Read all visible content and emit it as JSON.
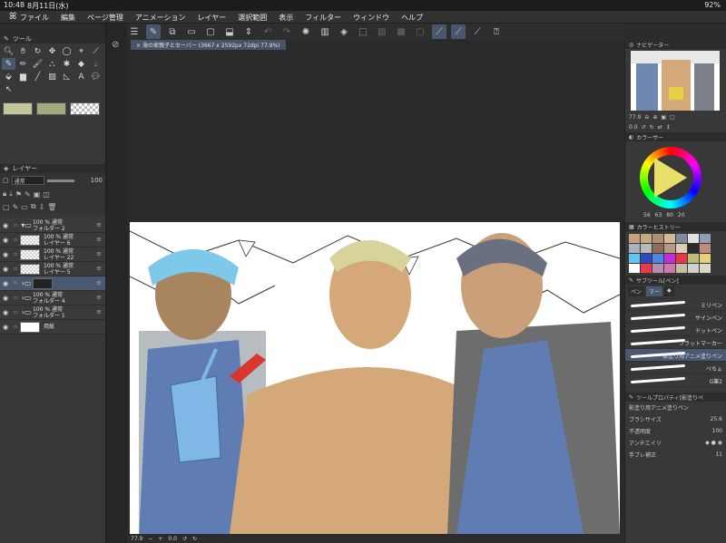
{
  "status": {
    "time": "10:48",
    "date": "8月11日(水)",
    "battery": "92%"
  },
  "menu": {
    "items": [
      "ファイル",
      "編集",
      "ページ管理",
      "アニメーション",
      "レイヤー",
      "選択範囲",
      "表示",
      "フィルター",
      "ウィンドウ",
      "ヘルプ"
    ]
  },
  "tool_panel": {
    "title": "ツール"
  },
  "layer_panel": {
    "title": "レイヤー",
    "blend_mode": "通常",
    "opacity": "100",
    "layers": [
      {
        "line1": "100 % 通常",
        "line2": "フォルダー 2",
        "type": "folder"
      },
      {
        "line1": "100 % 通常",
        "line2": "レイヤー 6",
        "type": "layer"
      },
      {
        "line1": "100 % 通常",
        "line2": "レイヤー 22",
        "type": "layer"
      },
      {
        "line1": "100 % 通常",
        "line2": "レイヤー 5",
        "type": "layer"
      },
      {
        "line1": "",
        "line2": "",
        "type": "selected-folder"
      },
      {
        "line1": "100 % 通常",
        "line2": "フォルダー 4",
        "type": "folder"
      },
      {
        "line1": "100 % 通常",
        "line2": "フォルダー 1",
        "type": "folder"
      },
      {
        "line1": "",
        "line2": "用紙",
        "type": "paper"
      }
    ]
  },
  "document_tab": "海の家親子とセーバー (3667 x 2592px 72dpi 77.9%)",
  "bottom": {
    "zoom": "77.9",
    "angle": "0.0"
  },
  "navigator": {
    "title": "ナビゲーター",
    "zoom": "77.9",
    "angle": "0.0"
  },
  "color_panel": {
    "title": "カラーサー",
    "h": "56",
    "s": "63",
    "v": "80",
    "extra": "20"
  },
  "color_history": {
    "title": "カラーヒストリー"
  },
  "subtool": {
    "title": "サブツール[ペン]",
    "tabs": [
      "ペン",
      "マー",
      "◆"
    ],
    "brushes": [
      {
        "label": "ミリペン"
      },
      {
        "label": "サインペン"
      },
      {
        "label": "ドットペン"
      },
      {
        "label": "フラットマーカー"
      },
      {
        "label": "影塗り用アニメ塗りペン"
      },
      {
        "label": "べちょ"
      },
      {
        "label": "G筆2"
      }
    ]
  },
  "tool_property": {
    "title": "ツールプロパティ[影塗りペ",
    "preset": "影塗り用アニメ塗りペン",
    "brush_size_label": "ブラシサイズ",
    "brush_size": "25.6",
    "opacity_label": "不透明度",
    "opacity": "100",
    "aa_label": "アンチエイリ",
    "stabilize_label": "手ブレ補正",
    "stabilize": "11"
  },
  "colors": {
    "swatch_main": "#c2c49a",
    "swatch_sub": "#a2a97c",
    "skin": "#d5a879",
    "apron": "#5f7db3",
    "headband": "#7ec8ea",
    "cup": "#7fb8e6",
    "history": [
      "#c6a27e",
      "#c5a983",
      "#ad8f73",
      "#d5ba98",
      "#7f8a9d",
      "#e2e2e2",
      "#8ea0b5",
      "#a8b2c0",
      "#b9b9b9",
      "#8e6d58",
      "#b59a84",
      "#e0cdb8",
      "#2b2b2b",
      "#c28b7a",
      "#62c4ef",
      "#2e49b8",
      "#4e86e5",
      "#c02fd4",
      "#e7374a",
      "#bdbd7a",
      "#e6d07f",
      "#ffffff",
      "#e73a4e",
      "#b98bb0",
      "#c97ba9",
      "#c7bda4",
      "#d0d0d0",
      "#dad8c7"
    ]
  }
}
